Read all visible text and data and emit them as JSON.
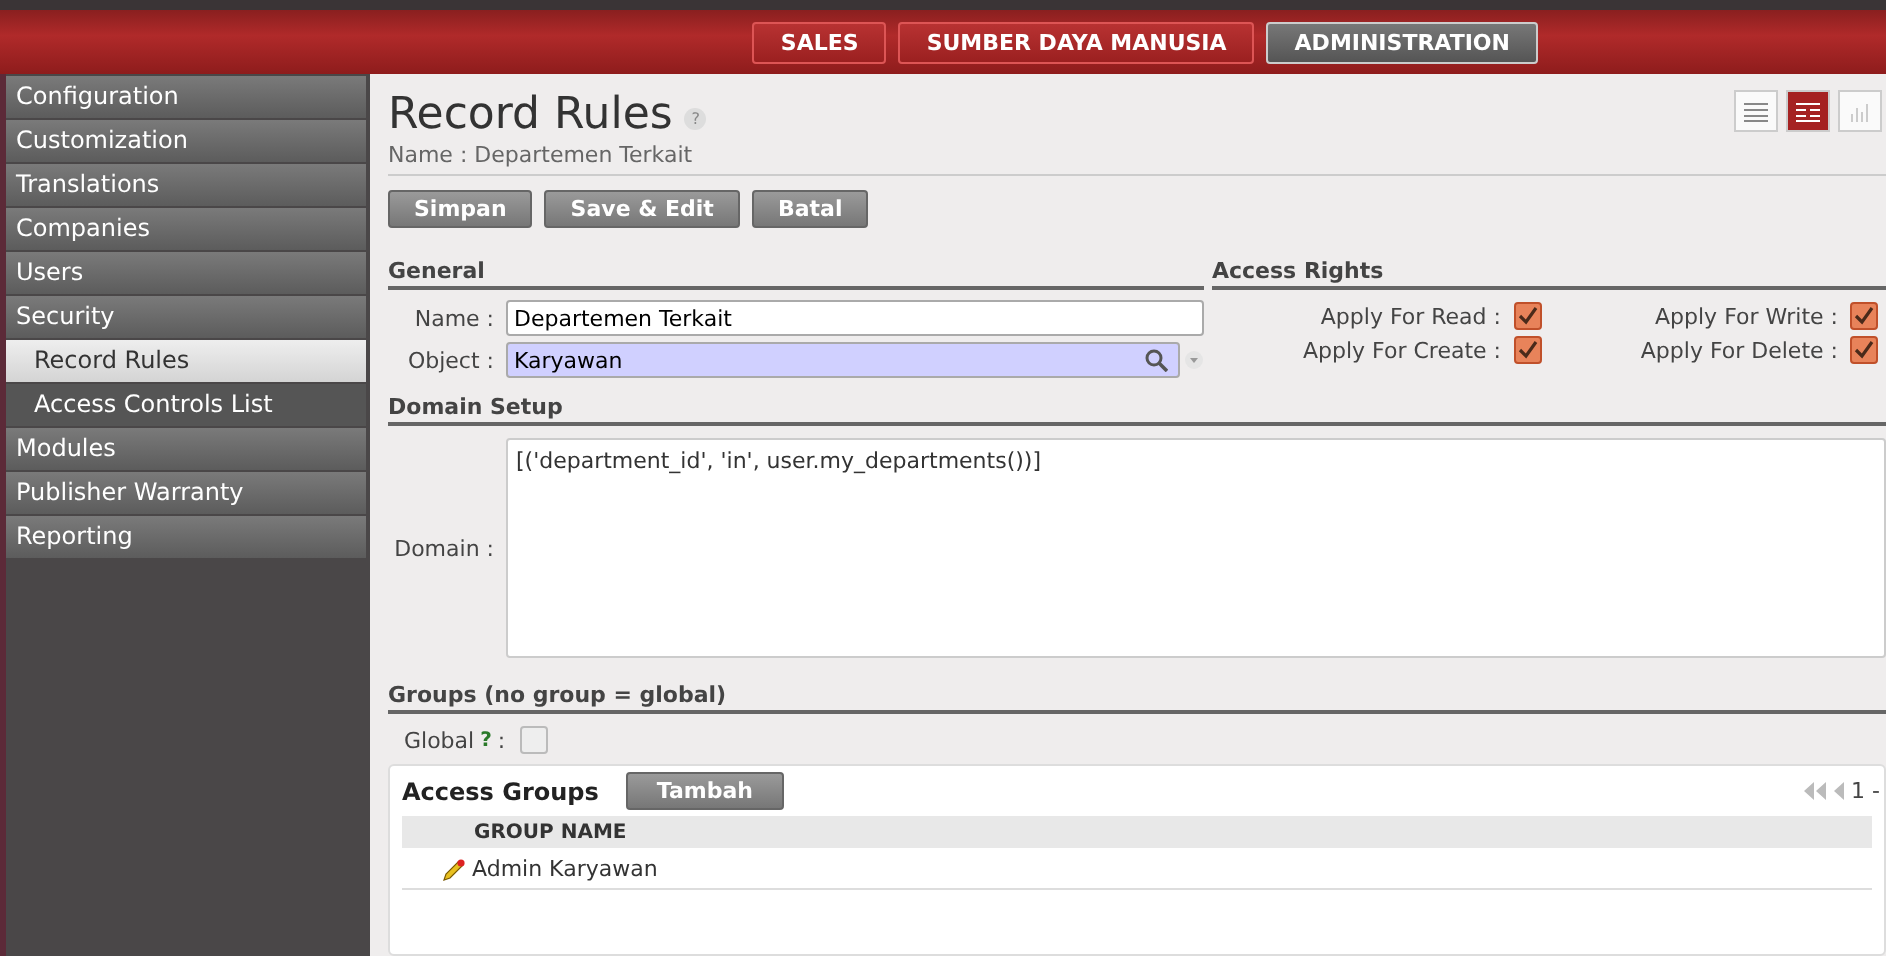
{
  "top_menu": [
    {
      "label": "SALES",
      "selected": false
    },
    {
      "label": "SUMBER DAYA MANUSIA",
      "selected": false
    },
    {
      "label": "ADMINISTRATION",
      "selected": true
    }
  ],
  "sidebar": {
    "items": [
      {
        "label": "Configuration"
      },
      {
        "label": "Customization"
      },
      {
        "label": "Translations"
      },
      {
        "label": "Companies"
      },
      {
        "label": "Users"
      },
      {
        "label": "Security",
        "children": [
          {
            "label": "Record Rules",
            "selected": true
          },
          {
            "label": "Access Controls List",
            "selected": false
          }
        ]
      },
      {
        "label": "Modules"
      },
      {
        "label": "Publisher Warranty"
      },
      {
        "label": "Reporting"
      }
    ]
  },
  "header": {
    "title": "Record Rules",
    "help": "?",
    "subtitle": "Name : Departemen Terkait"
  },
  "views": [
    {
      "kind": "list",
      "selected": false
    },
    {
      "kind": "form",
      "selected": true
    },
    {
      "kind": "graph",
      "selected": false
    }
  ],
  "buttons": [
    "Simpan",
    "Save & Edit",
    "Batal"
  ],
  "general": {
    "title": "General",
    "name_label": "Name :",
    "name_value": "Departemen Terkait",
    "object_label": "Object :",
    "object_value": "Karyawan"
  },
  "access_rights": {
    "title": "Access Rights",
    "items": [
      {
        "label": "Apply For Read :",
        "checked": true
      },
      {
        "label": "Apply For Write :",
        "checked": true
      },
      {
        "label": "Apply For Create :",
        "checked": true
      },
      {
        "label": "Apply For Delete :",
        "checked": true
      }
    ]
  },
  "domain": {
    "title": "Domain Setup",
    "label": "Domain :",
    "value": "[('department_id', 'in', user.my_departments())]"
  },
  "groups": {
    "title": "Groups (no group = global)",
    "global_label": "Global",
    "global_help": "?",
    "global_colon": ":",
    "global_checked": false,
    "list_title": "Access Groups",
    "add_button": "Tambah",
    "pager": "1 -",
    "column": "GROUP NAME",
    "rows": [
      "Admin Karyawan"
    ]
  }
}
